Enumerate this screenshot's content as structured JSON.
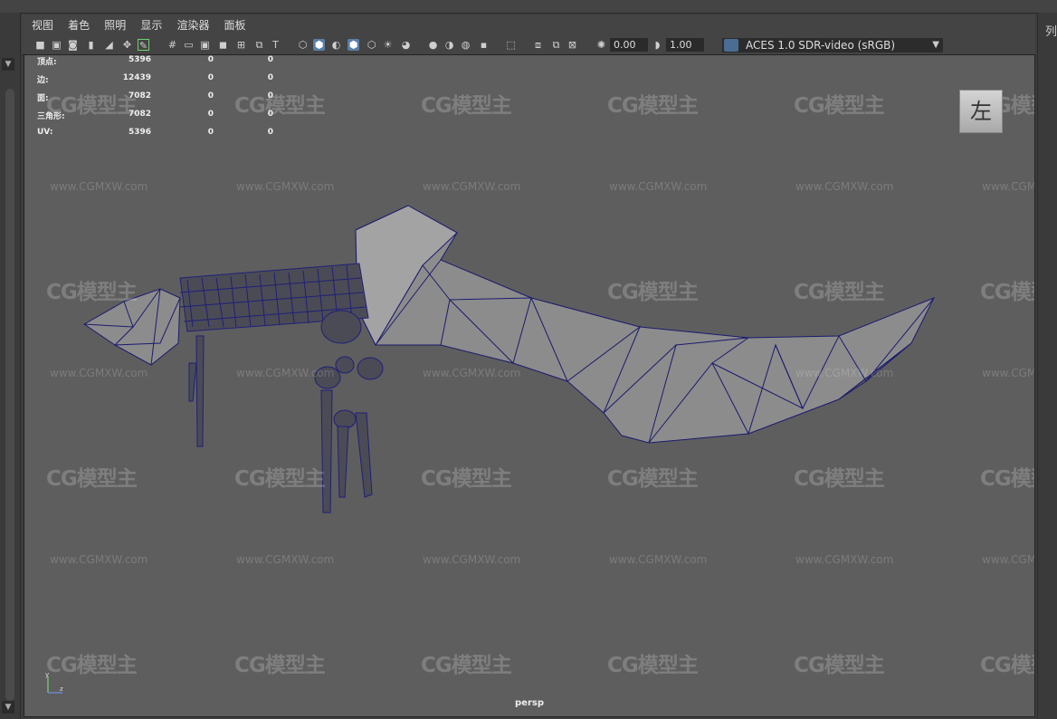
{
  "menu": [
    "视图",
    "着色",
    "照明",
    "显示",
    "渲染器",
    "面板"
  ],
  "toolbar": {
    "exposure": "0.00",
    "gamma": "1.00",
    "color_space": "ACES 1.0 SDR-video (sRGB)"
  },
  "stats": {
    "rows": [
      {
        "label": "顶点:",
        "v1": "5396",
        "v2": "0",
        "v3": "0"
      },
      {
        "label": "边:",
        "v1": "12439",
        "v2": "0",
        "v3": "0"
      },
      {
        "label": "面:",
        "v1": "7082",
        "v2": "0",
        "v3": "0"
      },
      {
        "label": "三角形:",
        "v1": "7082",
        "v2": "0",
        "v3": "0"
      },
      {
        "label": "UV:",
        "v1": "5396",
        "v2": "0",
        "v3": "0"
      }
    ]
  },
  "viewcube_label": "左",
  "camera_name": "persp",
  "right_panel_label": "列",
  "watermark": {
    "logo": "CG模型主",
    "url": "www.CGMXW.com"
  },
  "axis": {
    "y": "y",
    "z": "z"
  },
  "colors": {
    "mesh_fill": "#8a8a8a",
    "wire": "#1a1a6e",
    "viewport_bg": "#5e5e5e",
    "accent": "#5a7fa6"
  }
}
